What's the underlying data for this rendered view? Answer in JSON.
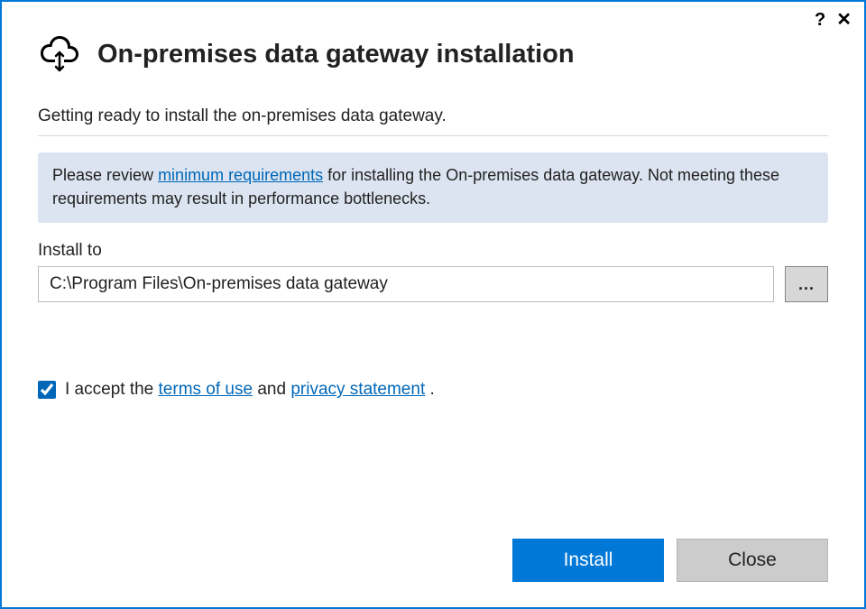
{
  "header": {
    "title": "On-premises data gateway installation"
  },
  "subtitle": "Getting ready to install the on-premises data gateway.",
  "info": {
    "prefix": "Please review ",
    "link": "minimum requirements",
    "suffix": " for installing the On-premises data gateway. Not meeting these requirements may result in performance bottlenecks."
  },
  "install": {
    "label": "Install to",
    "path": "C:\\Program Files\\On-premises data gateway",
    "browse_label": "..."
  },
  "accept": {
    "checked": true,
    "text_prefix": "I accept the ",
    "terms_link": "terms of use",
    "text_mid": " and ",
    "privacy_link": "privacy statement",
    "text_suffix": " ."
  },
  "buttons": {
    "install": "Install",
    "close": "Close"
  },
  "titlebar": {
    "help": "?",
    "close": "✕"
  }
}
